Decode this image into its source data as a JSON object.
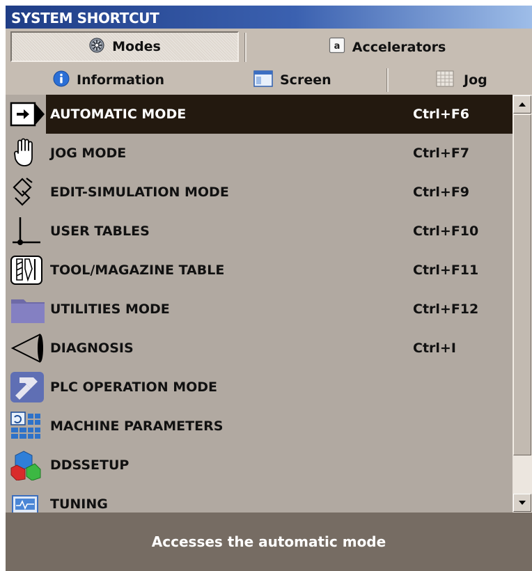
{
  "window": {
    "title": "SYSTEM SHORTCUT"
  },
  "tabs_top": [
    {
      "label": "Modes",
      "icon": "gear-icon",
      "active": true
    },
    {
      "label": "Accelerators",
      "icon": "letter-a-key-icon",
      "icon_text": "a",
      "active": false
    }
  ],
  "tabs_sub": [
    {
      "label": "Information",
      "icon": "info-icon"
    },
    {
      "label": "Screen",
      "icon": "screen-window-icon"
    },
    {
      "label": "Jog",
      "icon": "grid-table-icon"
    }
  ],
  "items": [
    {
      "label": "AUTOMATIC MODE",
      "shortcut": "Ctrl+F6",
      "icon": "arrow-right-icon",
      "selected": true
    },
    {
      "label": "JOG MODE",
      "shortcut": "Ctrl+F7",
      "icon": "hand-icon"
    },
    {
      "label": "EDIT-SIMULATION MODE",
      "shortcut": "Ctrl+F9",
      "icon": "diamond-edit-icon"
    },
    {
      "label": "USER TABLES",
      "shortcut": "Ctrl+F10",
      "icon": "axis-icon"
    },
    {
      "label": "TOOL/MAGAZINE TABLE",
      "shortcut": "Ctrl+F11",
      "icon": "tool-icon"
    },
    {
      "label": "UTILITIES MODE",
      "shortcut": "Ctrl+F12",
      "icon": "folder-icon"
    },
    {
      "label": "DIAGNOSIS",
      "shortcut": "Ctrl+I",
      "icon": "cone-diagnosis-icon"
    },
    {
      "label": "PLC OPERATION MODE",
      "shortcut": "",
      "icon": "hammer-icon"
    },
    {
      "label": "MACHINE PARAMETERS",
      "shortcut": "",
      "icon": "parameters-grid-icon"
    },
    {
      "label": "DDSSETUP",
      "shortcut": "",
      "icon": "cubes-icon"
    },
    {
      "label": "TUNING",
      "shortcut": "",
      "icon": "monitor-wave-icon"
    }
  ],
  "status": {
    "text": "Accesses the automatic mode"
  },
  "colors": {
    "selected_bg": "#23190f",
    "list_bg": "#b1a9a1",
    "status_bg": "#766c63",
    "title_bar": "#2a4a96"
  }
}
